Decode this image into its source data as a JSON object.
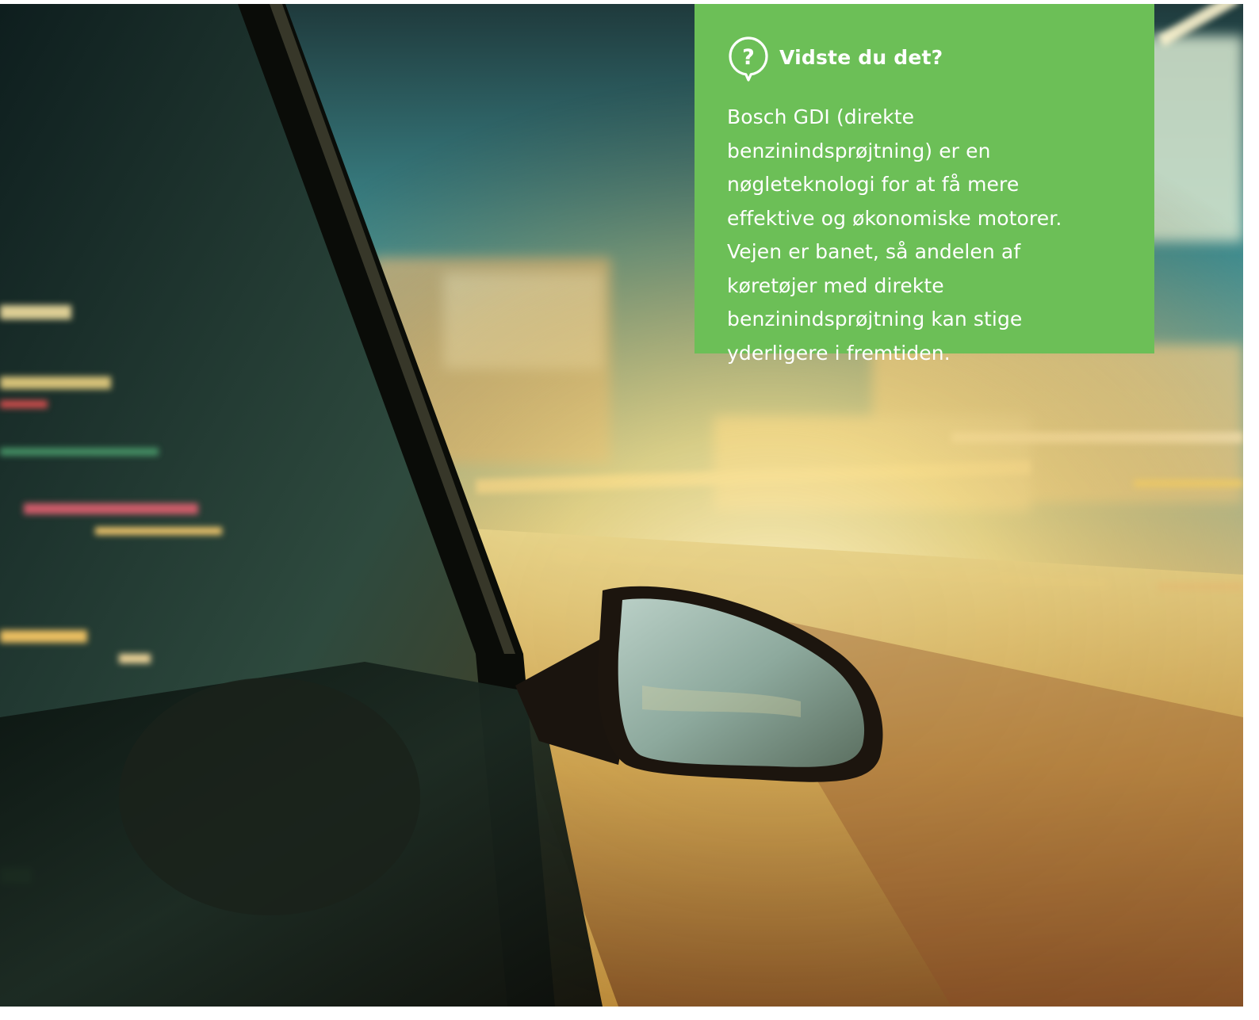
{
  "photo": {
    "alt": "car-side-mirror-night-city-motion-blur"
  },
  "info_box": {
    "background_color": "#6cbf57",
    "icon": "question-speech-bubble-icon",
    "title": "Vidste du det?",
    "body": "Bosch GDI (direkte benzinindsprøjtning) er en nøgleteknologi for at få mere effektive og økonomiske motorer. Vejen er banet, så andelen af køretøjer med direkte benzinindsprøjtning kan stige yderligere i fremtiden."
  }
}
